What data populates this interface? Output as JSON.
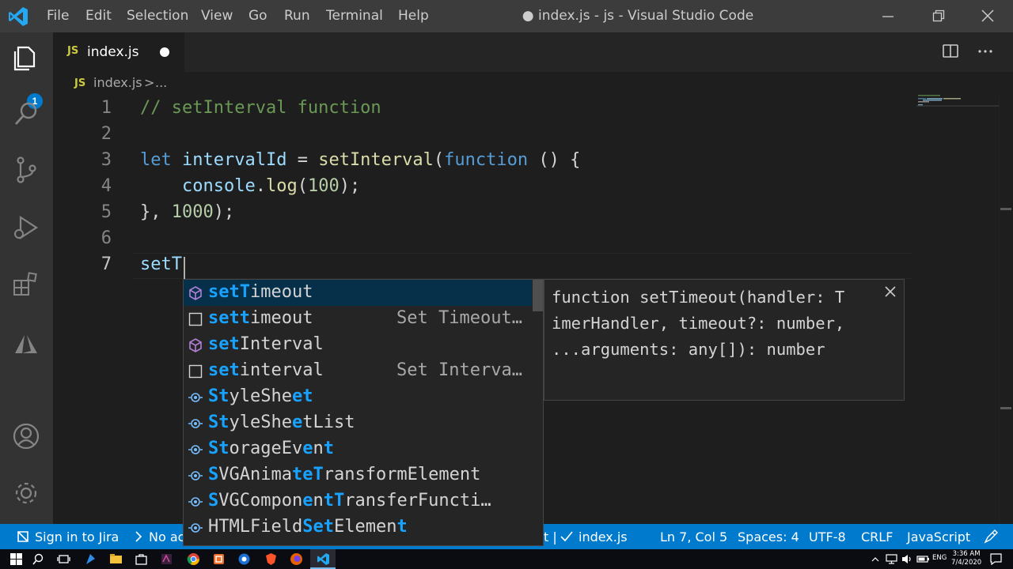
{
  "app": {
    "window_title": "● index.js - js - Visual Studio Code",
    "menu": [
      "File",
      "Edit",
      "Selection",
      "View",
      "Go",
      "Run",
      "Terminal",
      "Help"
    ]
  },
  "activity_bar": {
    "items": [
      "explorer-icon",
      "search-icon",
      "source-control-icon",
      "run-debug-icon",
      "extensions-icon",
      "azure-icon",
      "accounts-icon",
      "manage-gear-icon"
    ],
    "scm_badge": "1"
  },
  "tabs": [
    {
      "icon": "JS",
      "label": "index.js",
      "modified": true
    }
  ],
  "breadcrumb": {
    "icon": "JS",
    "file": "index.js",
    "separator": ">",
    "more": "..."
  },
  "editor": {
    "line_numbers": [
      "1",
      "2",
      "3",
      "4",
      "5",
      "6",
      "7"
    ],
    "lines": {
      "l1": "// setInterval function",
      "l3_kw": "let",
      "l3_var": "intervalId",
      "l3_eq": " = ",
      "l3_fn": "setInterval",
      "l3_open": "(",
      "l3_kw2": "function",
      "l3_rest": " () {",
      "l4_indent": "    ",
      "l4_obj": "console",
      "l4_dot": ".",
      "l4_fn": "log",
      "l4_open": "(",
      "l4_num": "100",
      "l4_close": ");",
      "l5_a": "}, ",
      "l5_num": "1000",
      "l5_close": ");",
      "l7": "setT"
    }
  },
  "suggest": {
    "items": [
      {
        "icon": "method-icon",
        "match1": "setT",
        "rest1": "imeout",
        "detail": ""
      },
      {
        "icon": "text-icon",
        "match1": "sett",
        "rest1": "imeout",
        "detail": "Set Timeout…"
      },
      {
        "icon": "method-icon",
        "match1": "set",
        "rest1": "Interval",
        "detail": ""
      },
      {
        "icon": "text-icon",
        "match1": "set",
        "rest1": "interval",
        "detail": "Set Interva…"
      },
      {
        "icon": "interface-icon",
        "p1": "S",
        "p2": "t",
        "p3": "yleSh",
        "p4": "e",
        "p5": "e",
        "p6": "t",
        "detail": ""
      },
      {
        "icon": "interface-icon",
        "p1": "S",
        "p2": "t",
        "p3": "yleSh",
        "p4": "e",
        "p5": "e",
        "p6": "tList",
        "detail": ""
      },
      {
        "icon": "interface-icon",
        "p1": "S",
        "p2": "t",
        "p3": "orageEv",
        "p4": "e",
        "p5": "n",
        "p6": "t",
        "detail": ""
      },
      {
        "icon": "interface-icon",
        "p1": "S",
        "p2": "VGAnima",
        "p3": "t",
        "p4": "e",
        "p5": "T",
        "p6": "ransformElement",
        "detail": ""
      },
      {
        "icon": "interface-icon",
        "p1": "S",
        "p2": "VGCompon",
        "p3": "e",
        "p4": "n",
        "p5": "tT",
        "p6": "ransferFuncti…",
        "detail": ""
      },
      {
        "icon": "interface-icon",
        "p1": "HTMLField",
        "p2": "S",
        "p3": "e",
        "p4": "t",
        "p5": "Elemen",
        "p6": "t",
        "detail": ""
      }
    ],
    "details": [
      "function setTimeout(handler: T",
      "imerHandler, timeout?: number,",
      "...arguments: any[]): number"
    ]
  },
  "statusbar": {
    "jira": "Sign in to Jira",
    "no_active": "No ac",
    "partial": "t |",
    "check_file": "index.js",
    "position": "Ln 7, Col 5",
    "spaces": "Spaces: 4",
    "encoding": "UTF-8",
    "eol": "CRLF",
    "language": "JavaScript"
  },
  "taskbar": {
    "time": "3:36 AM",
    "date": "7/4/2020",
    "lang": "ENG"
  },
  "colors": {
    "accent": "#007acc",
    "match_highlight": "#18a3ff",
    "comment": "#6a9955",
    "keyword": "#569cd6",
    "function": "#dcdcaa",
    "variable": "#9cdcfe",
    "number": "#b5cea8"
  }
}
